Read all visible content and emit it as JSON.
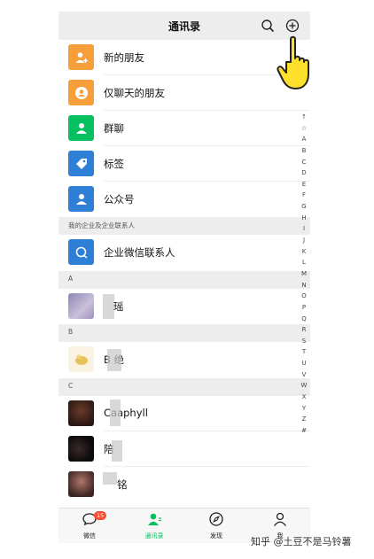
{
  "header": {
    "title": "通讯录",
    "search_icon": "search-icon",
    "add_icon": "plus-circle-icon"
  },
  "features": [
    {
      "label": "新的朋友",
      "icon": "add-friend-icon",
      "color": "#f59e3a"
    },
    {
      "label": "仅聊天的朋友",
      "icon": "chat-only-icon",
      "color": "#f59e3a"
    },
    {
      "label": "群聊",
      "icon": "group-icon",
      "color": "#07c160"
    },
    {
      "label": "标签",
      "icon": "tag-icon",
      "color": "#2f7fd6"
    },
    {
      "label": "公众号",
      "icon": "official-account-icon",
      "color": "#2f7fd6"
    }
  ],
  "enterprise": {
    "section": "我的企业及企业联系人",
    "label": "企业微信联系人",
    "icon": "enterprise-icon",
    "color": "#2f7fd6"
  },
  "contacts": [
    {
      "section": "A",
      "names": [
        "瑶"
      ]
    },
    {
      "section": "B",
      "names": [
        "B 绝"
      ]
    },
    {
      "section": "C",
      "names": [
        "Caaphyll",
        "陪",
        "铭"
      ]
    }
  ],
  "index_letters": [
    "↑",
    "☆",
    "A",
    "B",
    "C",
    "D",
    "E",
    "F",
    "G",
    "H",
    "I",
    "J",
    "K",
    "L",
    "M",
    "N",
    "O",
    "P",
    "Q",
    "R",
    "S",
    "T",
    "U",
    "V",
    "W",
    "X",
    "Y",
    "Z",
    "#"
  ],
  "tabbar": {
    "items": [
      {
        "label": "微信",
        "icon": "chat-bubble-icon",
        "badge": "15"
      },
      {
        "label": "通讯录",
        "icon": "contacts-icon",
        "active": true
      },
      {
        "label": "发现",
        "icon": "compass-icon"
      },
      {
        "label": "我",
        "icon": "person-icon"
      }
    ]
  },
  "watermark": "知乎 @土豆不是马铃薯",
  "colors": {
    "accent": "#07c160",
    "badge": "#f74c31",
    "header_bg": "#ededed"
  }
}
